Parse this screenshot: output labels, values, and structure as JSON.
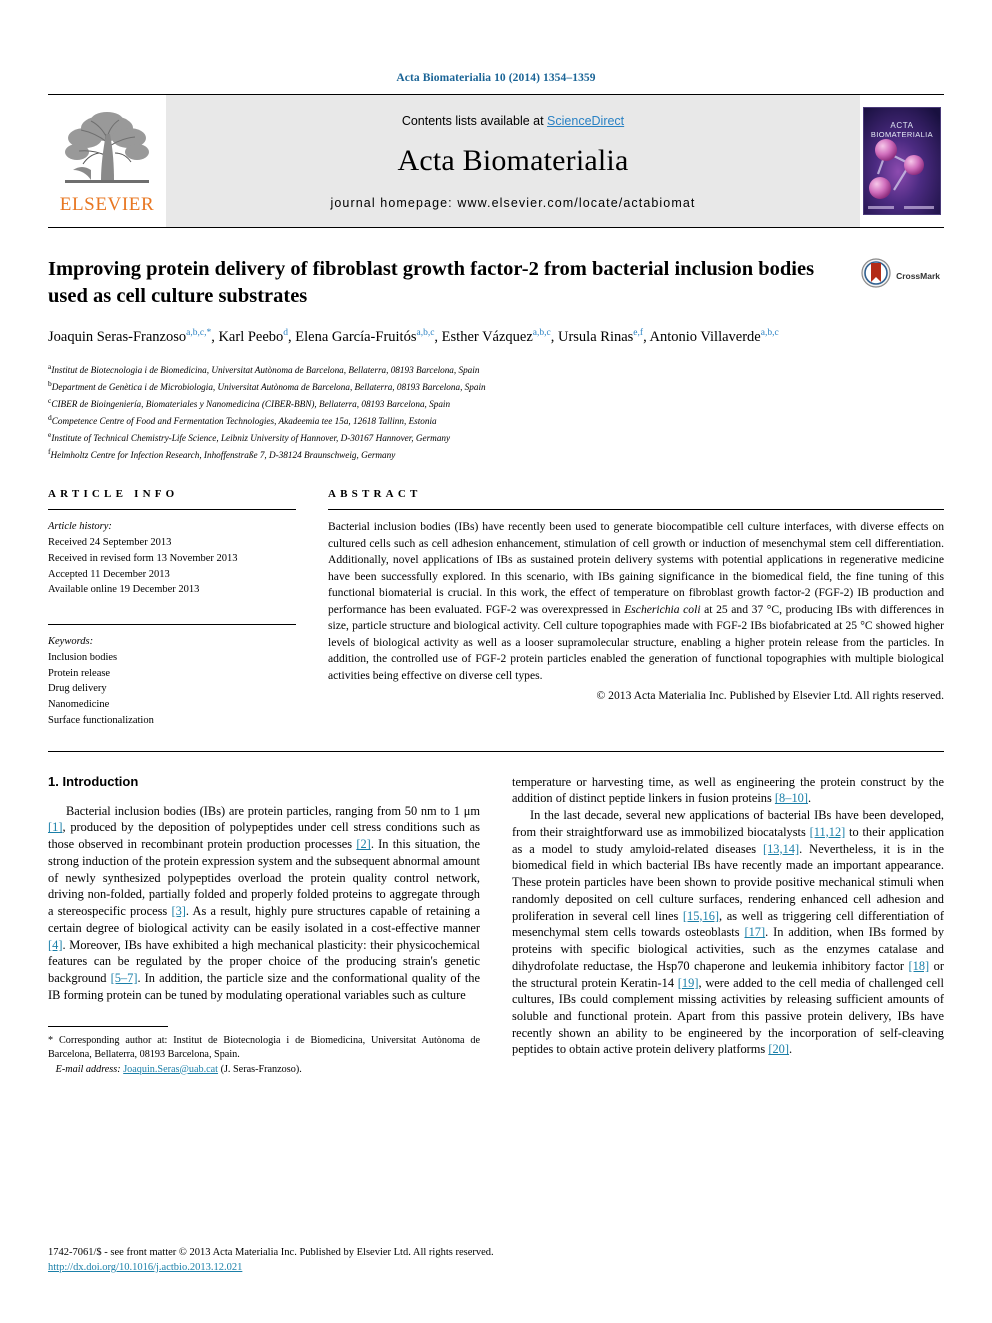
{
  "running_head": "Acta Biomaterialia 10 (2014) 1354–1359",
  "masthead": {
    "publisher_name": "ELSEVIER",
    "contents_prefix": "Contents lists available at ",
    "sciencedirect": "ScienceDirect",
    "journal_title": "Acta Biomaterialia",
    "homepage": "journal homepage: www.elsevier.com/locate/actabiomat",
    "cover_caption": "ACTA BIOMATERIALIA"
  },
  "article": {
    "title": "Improving protein delivery of fibroblast growth factor-2 from bacterial inclusion bodies used as cell culture substrates",
    "crossmark_label": "CrossMark",
    "authors": [
      {
        "name": "Joaquin Seras-Franzoso",
        "sup": "a,b,c,*"
      },
      {
        "name": "Karl Peebo",
        "sup": "d"
      },
      {
        "name": "Elena García-Fruitós",
        "sup": "a,b,c"
      },
      {
        "name": "Esther Vázquez",
        "sup": "a,b,c"
      },
      {
        "name": "Ursula Rinas",
        "sup": "e,f"
      },
      {
        "name": "Antonio Villaverde",
        "sup": "a,b,c"
      }
    ],
    "affiliations": [
      {
        "mark": "a",
        "text": "Institut de Biotecnologia i de Biomedicina, Universitat Autònoma de Barcelona, Bellaterra, 08193 Barcelona, Spain"
      },
      {
        "mark": "b",
        "text": "Department de Genètica i de Microbiologia, Universitat Autònoma de Barcelona, Bellaterra, 08193 Barcelona, Spain"
      },
      {
        "mark": "c",
        "text": "CIBER de Bioingeniería, Biomateriales y Nanomedicina (CIBER-BBN), Bellaterra, 08193 Barcelona, Spain"
      },
      {
        "mark": "d",
        "text": "Competence Centre of Food and Fermentation Technologies, Akadeemia tee 15a, 12618 Tallinn, Estonia"
      },
      {
        "mark": "e",
        "text": "Institute of Technical Chemistry-Life Science, Leibniz University of Hannover, D-30167 Hannover, Germany"
      },
      {
        "mark": "f",
        "text": "Helmholtz Centre for Infection Research, Inhoffenstraße 7, D-38124 Braunschweig, Germany"
      }
    ]
  },
  "article_info": {
    "heading": "ARTICLE INFO",
    "history_label": "Article history:",
    "history": [
      "Received 24 September 2013",
      "Received in revised form 13 November 2013",
      "Accepted 11 December 2013",
      "Available online 19 December 2013"
    ],
    "keywords_label": "Keywords:",
    "keywords": [
      "Inclusion bodies",
      "Protein release",
      "Drug delivery",
      "Nanomedicine",
      "Surface functionalization"
    ]
  },
  "abstract": {
    "heading": "ABSTRACT",
    "part1": "Bacterial inclusion bodies (IBs) have recently been used to generate biocompatible cell culture interfaces, with diverse effects on cultured cells such as cell adhesion enhancement, stimulation of cell growth or induction of mesenchymal stem cell differentiation. Additionally, novel applications of IBs as sustained protein delivery systems with potential applications in regenerative medicine have been successfully explored. In this scenario, with IBs gaining significance in the biomedical field, the fine tuning of this functional biomaterial is crucial. In this work, the effect of temperature on fibroblast growth factor-2 (FGF-2) IB production and performance has been evaluated. FGF-2 was overexpressed in ",
    "italic1": "Escherichia coli",
    "part2": " at 25 and 37 °C, producing IBs with differences in size, particle structure and biological activity. Cell culture topographies made with FGF-2 IBs biofabricated at 25 °C showed higher levels of biological activity as well as a looser supramolecular structure, enabling a higher protein release from the particles. In addition, the controlled use of FGF-2 protein particles enabled the generation of functional topographies with multiple biological activities being effective on diverse cell types.",
    "copyright": "© 2013 Acta Materialia Inc. Published by Elsevier Ltd. All rights reserved."
  },
  "intro": {
    "heading": "1. Introduction",
    "left_p1_a": "Bacterial inclusion bodies (IBs) are protein particles, ranging from 50 nm to 1 μm ",
    "ref1": "[1]",
    "left_p1_b": ", produced by the deposition of polypeptides under cell stress conditions such as those observed in recombinant protein production processes ",
    "ref2": "[2]",
    "left_p1_c": ". In this situation, the strong induction of the protein expression system and the subsequent abnormal amount of newly synthesized polypeptides overload the protein quality control network, driving non-folded, partially folded and properly folded proteins to aggregate through a stereospecific process ",
    "ref3": "[3]",
    "left_p1_d": ". As a result, highly pure structures capable of retaining a certain degree of biological activity can be easily isolated in a cost-effective manner ",
    "ref4": "[4]",
    "left_p1_e": ". Moreover, IBs have exhibited a high mechanical plasticity: their physicochemical features can be regulated by the proper choice of the producing strain's genetic background ",
    "ref5": "[5–7]",
    "left_p1_f": ". In addition, the particle size and the conformational quality of the IB forming protein can be tuned by modulating operational variables such as culture",
    "right_p1_a": "temperature or harvesting time, as well as engineering the protein construct by the addition of distinct peptide linkers in fusion proteins ",
    "ref8": "[8–10]",
    "right_p1_b": ".",
    "right_p2_a": "In the last decade, several new applications of bacterial IBs have been developed, from their straightforward use as immobilized biocatalysts ",
    "ref11": "[11,12]",
    "right_p2_b": " to their application as a model to study amyloid-related diseases ",
    "ref13": "[13,14]",
    "right_p2_c": ". Nevertheless, it is in the biomedical field in which bacterial IBs have recently made an important appearance. These protein particles have been shown to provide positive mechanical stimuli when randomly deposited on cell culture surfaces, rendering enhanced cell adhesion and proliferation in several cell lines ",
    "ref15": "[15,16]",
    "right_p2_d": ", as well as triggering cell differentiation of mesenchymal stem cells towards osteoblasts ",
    "ref17": "[17]",
    "right_p2_e": ". In addition, when IBs formed by proteins with specific biological activities, such as the enzymes catalase and dihydrofolate reductase, the Hsp70 chaperone and leukemia inhibitory factor ",
    "ref18": "[18]",
    "right_p2_f": " or the structural protein Keratin-14 ",
    "ref19": "[19]",
    "right_p2_g": ", were added to the cell media of challenged cell cultures, IBs could complement missing activities by releasing sufficient amounts of soluble and functional protein. Apart from this passive protein delivery, IBs have recently shown an ability to be engineered by the incorporation of self-cleaving peptides to obtain active protein delivery platforms ",
    "ref20": "[20]",
    "right_p2_h": "."
  },
  "footnote": {
    "star": "*",
    "corresponding": " Corresponding author at: Institut de Biotecnologia i de Biomedicina, Universitat Autònoma de Barcelona, Bellaterra, 08193 Barcelona, Spain.",
    "email_label": "E-mail address:",
    "email": "Joaquin.Seras@uab.cat",
    "email_owner": "(J. Seras-Franzoso)."
  },
  "page_footer": {
    "issn_line": "1742-7061/$ - see front matter © 2013 Acta Materialia Inc. Published by Elsevier Ltd. All rights reserved.",
    "doi": "http://dx.doi.org/10.1016/j.actbio.2013.12.021"
  },
  "colors": {
    "link": "#1a7fa8",
    "runhead": "#1a6496",
    "elsevier_orange": "#e87722",
    "sciencedirect": "#2a82c4",
    "masthead_bg": "#e8e8e8"
  }
}
